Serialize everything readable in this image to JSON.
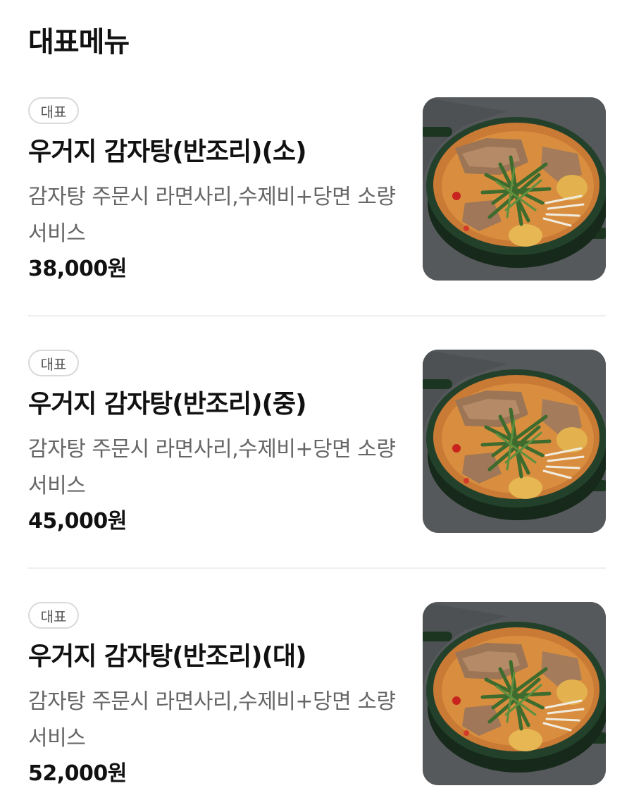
{
  "section": {
    "title": "대표메뉴"
  },
  "items": [
    {
      "badge": "대표",
      "name": "우거지 감자탕(반조리)(소)",
      "description": "감자탕 주문시 라면사리,수제비+당면 소량서비스",
      "price": "38,000원"
    },
    {
      "badge": "대표",
      "name": "우거지 감자탕(반조리)(중)",
      "description": "감자탕 주문시 라면사리,수제비+당면 소량서비스",
      "price": "45,000원"
    },
    {
      "badge": "대표",
      "name": "우거지 감자탕(반조리)(대)",
      "description": "감자탕 주문시 라면사리,수제비+당면 소량서비스",
      "price": "52,000원"
    }
  ],
  "colors": {
    "text_primary": "#111111",
    "text_secondary": "#666666",
    "badge_border": "#d9d9d9",
    "divider": "#eeeeee",
    "pot_green": "#1f3a24",
    "broth_orange": "#d98a3a"
  }
}
